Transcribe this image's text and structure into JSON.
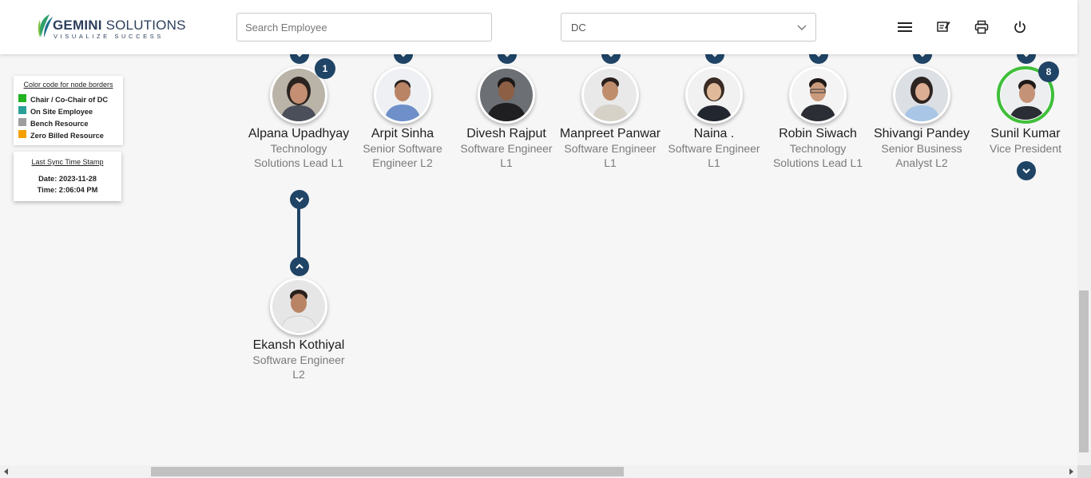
{
  "header": {
    "logo_name": "GEMINI SOLUTIONS",
    "logo_tagline": "VISUALIZE SUCCESS",
    "search_placeholder": "Search Employee",
    "dc_select_value": "DC",
    "icons": [
      "menu-icon",
      "edit-note-icon",
      "printer-icon",
      "power-icon"
    ]
  },
  "legend": {
    "title": "Color code for node borders",
    "items": [
      {
        "label": "Chair / Co-Chair of DC",
        "color": "#22b222"
      },
      {
        "label": "On Site Employee",
        "color": "#2aa198"
      },
      {
        "label": "Bench Resource",
        "color": "#9e9e9e"
      },
      {
        "label": "Zero Billed Resource",
        "color": "#f5a000"
      }
    ]
  },
  "sync": {
    "title": "Last Sync Time Stamp",
    "date": "Date: 2023-11-28",
    "time": "Time: 2:06:04 PM"
  },
  "nodes": [
    {
      "name": "Alpana Upadhyay",
      "role": "Technology Solutions Lead L1",
      "badge": "1"
    },
    {
      "name": "Arpit Sinha",
      "role": "Senior Software Engineer L2"
    },
    {
      "name": "Divesh Rajput",
      "role": "Software Engineer L1"
    },
    {
      "name": "Manpreet Panwar",
      "role": "Software Engineer L1"
    },
    {
      "name": "Naina .",
      "role": "Software Engineer L1"
    },
    {
      "name": "Robin Siwach",
      "role": "Technology Solutions Lead L1"
    },
    {
      "name": "Shivangi Pandey",
      "role": "Senior Business Analyst L2"
    },
    {
      "name": "Sunil Kumar",
      "role": "Vice President",
      "badge": "8",
      "border": "#3fbf3a"
    }
  ],
  "child_node": {
    "name": "Ekansh Kothiyal",
    "role": "Software Engineer L2"
  },
  "colors": {
    "accent": "#1f4466",
    "chair_border": "#3fbf3a"
  }
}
